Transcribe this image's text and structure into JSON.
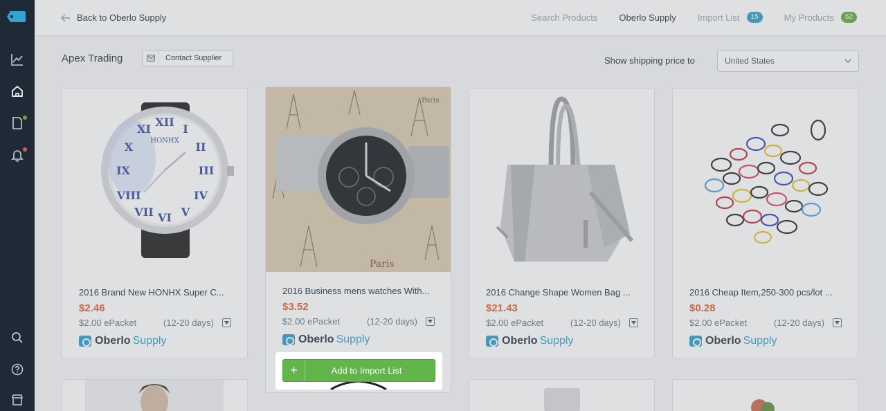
{
  "sidebar": {
    "items": [
      {
        "name": "analytics",
        "icon": "chart-line-icon"
      },
      {
        "name": "home",
        "icon": "house-icon"
      },
      {
        "name": "orders",
        "icon": "document-icon",
        "dot": "#5fa839"
      },
      {
        "name": "notifications",
        "icon": "bell-icon",
        "dot": "#e0603a"
      },
      {
        "name": "search",
        "icon": "search-icon"
      },
      {
        "name": "help",
        "icon": "question-icon"
      },
      {
        "name": "store",
        "icon": "storefront-icon"
      }
    ]
  },
  "topbar": {
    "back_label": "Back to Oberlo Supply",
    "nav": [
      {
        "label": "Search Products"
      },
      {
        "label": "Oberlo Supply"
      },
      {
        "label": "Import List",
        "badge": "15"
      },
      {
        "label": "My Products",
        "badge": "52"
      }
    ]
  },
  "supplier": {
    "name": "Apex Trading",
    "contact_label": "Contact Supplier",
    "shipping_label": "Show shipping price to",
    "shipping_country": "United States"
  },
  "products": [
    {
      "title": "2016 Brand New HONHX Super C...",
      "price": "$2.46",
      "shipping": "$2.00 ePacket",
      "days": "(12-20 days)",
      "watch_brand": "HONHX"
    },
    {
      "title": "2016 Business mens watches With...",
      "price": "$3.52",
      "shipping": "$2.00 ePacket",
      "days": "(12-20 days)",
      "bg_text_1": "Paris",
      "bg_text_2": "Paris"
    },
    {
      "title": "2016 Change Shape Women Bag ...",
      "price": "$21.43",
      "shipping": "$2.00 ePacket",
      "days": "(12-20 days)"
    },
    {
      "title": "2016 Cheap Item,250-300 pcs/lot ...",
      "price": "$0.28",
      "shipping": "$2.00 ePacket",
      "days": "(12-20 days)"
    }
  ],
  "brand": {
    "bold": "Oberlo",
    "light": "Supply"
  },
  "add_button_label": "Add to Import List",
  "colors": {
    "price": "#e05d2a",
    "add_button": "#61b54a",
    "brand": "#2c9cc9",
    "sidebar": "#1f2a36"
  }
}
